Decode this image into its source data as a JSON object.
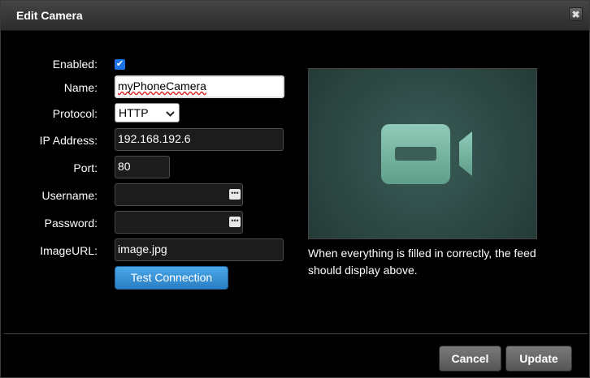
{
  "dialog": {
    "title": "Edit Camera",
    "close_glyph": "✖"
  },
  "form": {
    "enabled_label": "Enabled:",
    "enabled_checked": true,
    "check_glyph": "✔",
    "name_label": "Name:",
    "name_value": "myPhoneCamera",
    "protocol_label": "Protocol:",
    "protocol_value": "HTTP",
    "ip_label": "IP Address:",
    "ip_value": "192.168.192.6",
    "port_label": "Port:",
    "port_value": "80",
    "username_label": "Username:",
    "username_value": "",
    "password_label": "Password:",
    "password_value": "",
    "imageurl_label": "ImageURL:",
    "imageurl_value": "image.jpg",
    "test_button": "Test Connection"
  },
  "preview": {
    "icon": "video-camera-icon",
    "caption": "When everything is filled in correctly, the feed should display above."
  },
  "footer": {
    "cancel": "Cancel",
    "update": "Update"
  },
  "icons": {
    "dots": "•••",
    "chevron": "⌄"
  }
}
